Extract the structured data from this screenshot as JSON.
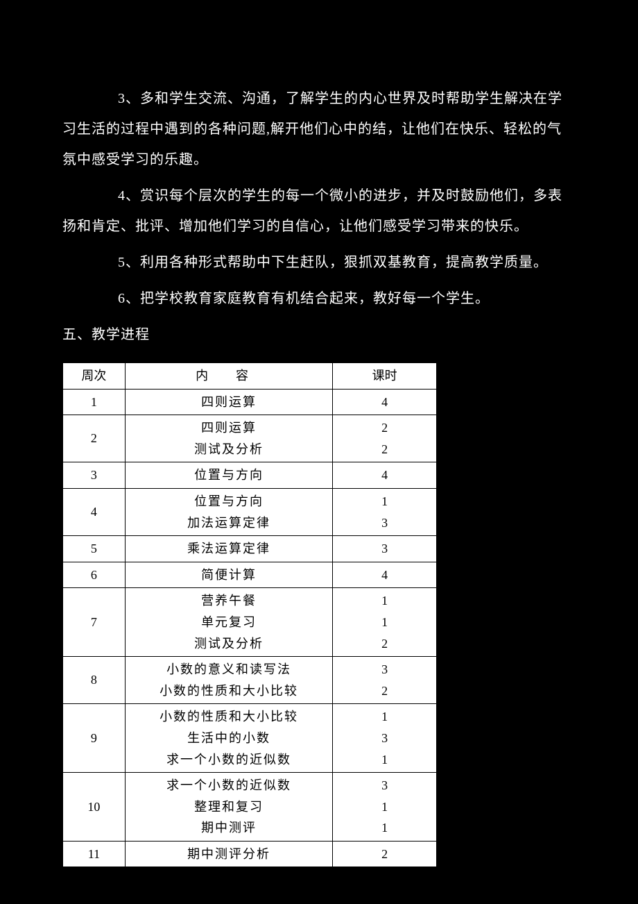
{
  "paragraphs": {
    "p3": "3、多和学生交流、沟通，了解学生的内心世界及时帮助学生解决在学习生活的过程中遇到的各种问题,解开他们心中的结，让他们在快乐、轻松的气氛中感受学习的乐趣。",
    "p4": "4、赏识每个层次的学生的每一个微小的进步，并及时鼓励他们，多表扬和肯定、批评、增加他们学习的自信心，让他们感受学习带来的快乐。",
    "p5": "5、利用各种形式帮助中下生赶队，狠抓双基教育，提高教学质量。",
    "p6": "6、把学校教育家庭教育有机结合起来，教好每一个学生。"
  },
  "section_title": "五、教学进程",
  "table": {
    "header": {
      "week": "周次",
      "content_inner": "内容",
      "hours": "课时"
    },
    "rows": [
      {
        "week": "1",
        "content": "四则运算",
        "hours": "4"
      },
      {
        "week": "2",
        "content": "四则运算\n测试及分析",
        "hours": "2\n2"
      },
      {
        "week": "3",
        "content": "位置与方向",
        "hours": "4"
      },
      {
        "week": "4",
        "content": "位置与方向\n加法运算定律",
        "hours": "1\n3"
      },
      {
        "week": "5",
        "content": "乘法运算定律",
        "hours": "3"
      },
      {
        "week": "6",
        "content": "简便计算",
        "hours": "4"
      },
      {
        "week": "7",
        "content": "营养午餐\n单元复习\n测试及分析",
        "hours": "1\n1\n2"
      },
      {
        "week": "8",
        "content": "小数的意义和读写法\n小数的性质和大小比较",
        "hours": "3\n2"
      },
      {
        "week": "9",
        "content": "小数的性质和大小比较\n生活中的小数\n求一个小数的近似数",
        "hours": "1\n3\n1"
      },
      {
        "week": "10",
        "content": "求一个小数的近似数\n整理和复习\n期中测评",
        "hours": "3\n1\n1"
      },
      {
        "week": "11",
        "content": "期中测评分析",
        "hours": "2"
      }
    ]
  }
}
